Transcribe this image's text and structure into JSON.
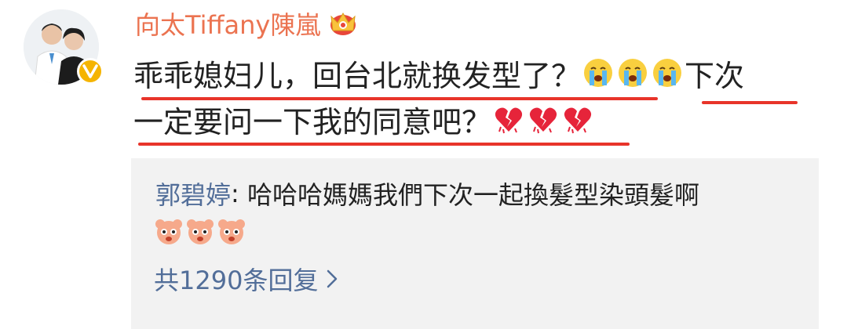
{
  "post": {
    "username": "向太Tiffany陳嵐",
    "line1_text": "乖乖媳妇儿，回台北就换发型了？",
    "line1_tail": "下次",
    "line2_text": "一定要问一下我的同意吧？",
    "emoji_line1": [
      "crying-emoji",
      "crying-emoji",
      "crying-emoji"
    ],
    "emoji_line2": [
      "broken-heart-icon",
      "broken-heart-icon",
      "broken-heart-icon"
    ]
  },
  "reply": {
    "user": "郭碧婷",
    "separator": ": ",
    "text": "哈哈哈媽媽我們下次一起換髮型染頭髮啊",
    "emoji": [
      "cute-face-emoji",
      "cute-face-emoji",
      "cute-face-emoji"
    ],
    "total_label": "共1290条回复"
  },
  "colors": {
    "username": "#eb7350",
    "link": "#526e99",
    "underline": "#e8342a",
    "reply_bg": "#f2f2f2",
    "verified": "#f5b400"
  }
}
